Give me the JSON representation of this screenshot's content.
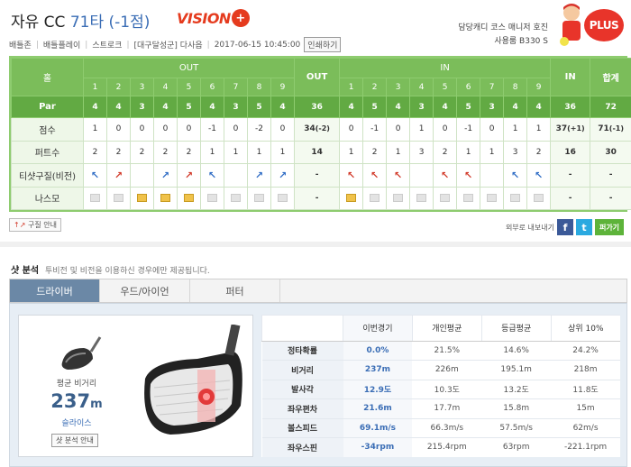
{
  "header": {
    "title_prefix": "자유 CC",
    "title_score": "71타 (-1점)",
    "brand": "VISION",
    "brand_mark": "+",
    "nav": [
      "배틀존",
      "배틀플레이",
      "스트로크",
      "[대구달성군] 다사읍",
      "2017-06-15 10:45:00"
    ],
    "print_label": "인쇄하기",
    "caddy_line1": "담당캐디 코스 매니저 호진",
    "caddy_line2": "사용룸 B330 S",
    "plus_label": "PLUS"
  },
  "scorecard": {
    "label_hole": "홀",
    "label_out": "OUT",
    "label_in": "IN",
    "label_total": "합계",
    "hole_numbers": [
      "1",
      "2",
      "3",
      "4",
      "5",
      "6",
      "7",
      "8",
      "9"
    ],
    "rows": {
      "par": {
        "label": "Par",
        "out": [
          "4",
          "4",
          "3",
          "4",
          "5",
          "4",
          "3",
          "5",
          "4"
        ],
        "out_sum": "36",
        "in": [
          "4",
          "5",
          "4",
          "3",
          "4",
          "5",
          "3",
          "4",
          "4"
        ],
        "in_sum": "36",
        "total": "72"
      },
      "score": {
        "label": "점수",
        "out": [
          "1",
          "0",
          "0",
          "0",
          "0",
          "-1",
          "0",
          "-2",
          "0"
        ],
        "out_sum": "34",
        "out_sum_note": "(-2)",
        "in": [
          "0",
          "-1",
          "0",
          "1",
          "0",
          "-1",
          "0",
          "1",
          "1"
        ],
        "in_sum": "37",
        "in_sum_note": "(+1)",
        "total": "71",
        "total_note": "(-1)"
      },
      "putts": {
        "label": "퍼트수",
        "out": [
          "2",
          "2",
          "2",
          "2",
          "2",
          "1",
          "1",
          "1",
          "1"
        ],
        "out_sum": "14",
        "in": [
          "1",
          "2",
          "1",
          "3",
          "2",
          "1",
          "1",
          "3",
          "2"
        ],
        "in_sum": "16",
        "total": "30"
      },
      "tee": {
        "label": "티샷구질(비전)",
        "out": [
          "↖",
          "↗",
          "",
          "↗",
          "↗",
          "↖",
          "",
          "↗",
          "↗"
        ],
        "out_sum": "-",
        "in": [
          "↖",
          "↖",
          "↖",
          "",
          "↖",
          "↖",
          "",
          "↖",
          "↖"
        ],
        "in_sum": "-",
        "total": "-"
      },
      "nasmo": {
        "label": "나스모",
        "out_sum": "-",
        "in_sum": "-",
        "total": "-"
      }
    },
    "tee_colors": {
      "out": [
        "b",
        "r",
        "",
        "b",
        "r",
        "b",
        "",
        "b",
        "b"
      ],
      "in": [
        "r",
        "r",
        "r",
        "",
        "r",
        "r",
        "",
        "b",
        "b"
      ]
    },
    "nasmo_on": {
      "out": [
        false,
        false,
        true,
        true,
        true,
        false,
        false,
        false,
        false
      ],
      "in": [
        true,
        false,
        false,
        false,
        false,
        false,
        false,
        false,
        false
      ]
    }
  },
  "legend_label": "구질 안내",
  "share": {
    "label": "외부로 내보내기",
    "fb": "f",
    "tw": "t",
    "pick": "퍼가기"
  },
  "shot": {
    "heading": "샷 분석",
    "desc": "투비전 및 비전을 이용하신 경우에만 제공됩니다.",
    "tabs": [
      "드라이버",
      "우드/아이언",
      "퍼터"
    ],
    "avg_label": "평균 비거리",
    "avg_value": "237",
    "avg_unit": "m",
    "shot_shape": "슬라이스",
    "guide_label": "샷 분석 안내",
    "stats_headers": [
      "이번경기",
      "개인평균",
      "등급평균",
      "상위 10%"
    ],
    "stats_rows": [
      {
        "label": "정타확률",
        "values": [
          "0.0%",
          "21.5%",
          "14.6%",
          "24.2%"
        ]
      },
      {
        "label": "비거리",
        "values": [
          "237m",
          "226m",
          "195.1m",
          "218m"
        ]
      },
      {
        "label": "발사각",
        "values": [
          "12.9도",
          "10.3도",
          "13.2도",
          "11.8도"
        ]
      },
      {
        "label": "좌우편차",
        "values": [
          "21.6m",
          "17.7m",
          "15.8m",
          "15m"
        ]
      },
      {
        "label": "볼스피드",
        "values": [
          "69.1m/s",
          "66.3m/s",
          "57.5m/s",
          "62m/s"
        ]
      },
      {
        "label": "좌우스핀",
        "values": [
          "-34rpm",
          "215.4rpm",
          "63rpm",
          "-221.1rpm"
        ]
      }
    ]
  },
  "colors": {
    "green": "#7bbd5a",
    "par_green": "#62aa43",
    "accent_blue": "#3a6db5",
    "brand_red": "#e53b1e",
    "tab_active": "#6b88a6"
  }
}
